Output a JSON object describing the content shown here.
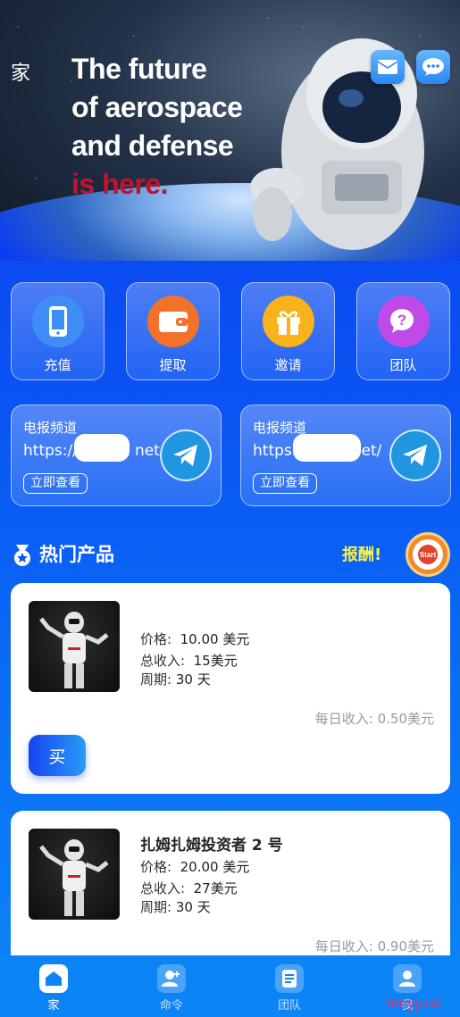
{
  "header": {
    "home_label": "家",
    "headline": [
      "The future",
      "of aerospace",
      "and defense"
    ],
    "headline_red": "is here."
  },
  "actions": [
    {
      "label": "充值",
      "icon": "phone-icon",
      "color": "#3f8ef5"
    },
    {
      "label": "提取",
      "icon": "wallet-icon",
      "color": "#f2722a"
    },
    {
      "label": "邀请",
      "icon": "gift-icon",
      "color": "#f8b21a"
    },
    {
      "label": "团队",
      "icon": "help-chat-icon",
      "color": "#c04ae8"
    }
  ],
  "channels": [
    {
      "title": "电报频道",
      "url_prefix": "https://",
      "url_suffix": "net/",
      "button": "立即查看"
    },
    {
      "title": "电报频道",
      "url_prefix": "https:",
      "url_suffix": "et/",
      "button": "立即查看"
    }
  ],
  "section": {
    "title": "热门产品",
    "reward": "报酬!",
    "badge": "Start"
  },
  "products": [
    {
      "name": "",
      "price_label": "价格:",
      "price": "10.00 美元",
      "income_label": "总收入:",
      "income": "15美元",
      "period_label": "周期:",
      "period": "30 天",
      "daily": "每日收入: 0.50美元",
      "buy": "买"
    },
    {
      "name": "扎姆扎姆投资者 2 号",
      "price_label": "价格:",
      "price": "20.00 美元",
      "income_label": "总收入:",
      "income": "27美元",
      "period_label": "周期:",
      "period": "30 天",
      "daily": "每日收入: 0.90美元"
    }
  ],
  "nav": [
    {
      "label": "家",
      "icon": "home-icon",
      "active": true
    },
    {
      "label": "命令",
      "icon": "add-user-icon",
      "active": false
    },
    {
      "label": "团队",
      "icon": "document-icon",
      "active": false
    },
    {
      "label": "我",
      "icon": "user-icon",
      "active": false
    }
  ],
  "watermark": "moyy.us"
}
